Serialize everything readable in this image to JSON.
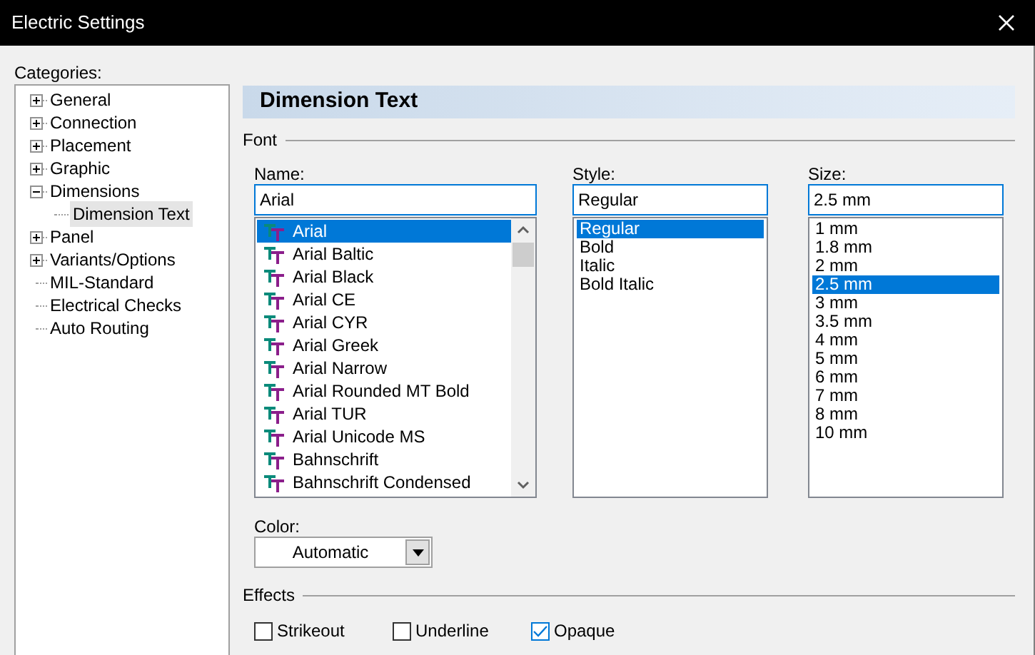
{
  "window": {
    "title": "Electric Settings"
  },
  "categories": {
    "label": "Categories:",
    "items": [
      {
        "label": "General",
        "expanded": false,
        "selected": false
      },
      {
        "label": "Connection",
        "expanded": false,
        "selected": false
      },
      {
        "label": "Placement",
        "expanded": false,
        "selected": false
      },
      {
        "label": "Graphic",
        "expanded": false,
        "selected": false
      },
      {
        "label": "Dimensions",
        "expanded": true,
        "selected": false,
        "children": [
          {
            "label": "Dimension Text",
            "selected": true
          }
        ]
      },
      {
        "label": "Panel",
        "expanded": false,
        "selected": false
      },
      {
        "label": "Variants/Options",
        "expanded": false,
        "selected": false
      },
      {
        "label": "MIL-Standard",
        "selected": false
      },
      {
        "label": "Electrical Checks",
        "selected": false
      },
      {
        "label": "Auto Routing",
        "selected": false
      }
    ]
  },
  "panel": {
    "title": "Dimension Text",
    "font_group": "Font",
    "name": {
      "label": "Name:",
      "value": "Arial",
      "items": [
        {
          "label": "Arial",
          "selected": true
        },
        {
          "label": "Arial Baltic",
          "selected": false
        },
        {
          "label": "Arial Black",
          "selected": false
        },
        {
          "label": "Arial CE",
          "selected": false
        },
        {
          "label": "Arial CYR",
          "selected": false
        },
        {
          "label": "Arial Greek",
          "selected": false
        },
        {
          "label": "Arial Narrow",
          "selected": false
        },
        {
          "label": "Arial Rounded MT Bold",
          "selected": false
        },
        {
          "label": "Arial TUR",
          "selected": false
        },
        {
          "label": "Arial Unicode MS",
          "selected": false
        },
        {
          "label": "Bahnschrift",
          "selected": false
        },
        {
          "label": "Bahnschrift Condensed",
          "selected": false
        }
      ]
    },
    "style": {
      "label": "Style:",
      "value": "Regular",
      "items": [
        {
          "label": "Regular",
          "selected": true
        },
        {
          "label": "Bold",
          "selected": false
        },
        {
          "label": "Italic",
          "selected": false
        },
        {
          "label": "Bold Italic",
          "selected": false
        }
      ]
    },
    "size": {
      "label": "Size:",
      "value": "2.5 mm",
      "items": [
        {
          "label": "1 mm",
          "selected": false
        },
        {
          "label": "1.8 mm",
          "selected": false
        },
        {
          "label": "2 mm",
          "selected": false
        },
        {
          "label": "2.5 mm",
          "selected": true
        },
        {
          "label": "3 mm",
          "selected": false
        },
        {
          "label": "3.5 mm",
          "selected": false
        },
        {
          "label": "4 mm",
          "selected": false
        },
        {
          "label": "5 mm",
          "selected": false
        },
        {
          "label": "6 mm",
          "selected": false
        },
        {
          "label": "7 mm",
          "selected": false
        },
        {
          "label": "8 mm",
          "selected": false
        },
        {
          "label": "10 mm",
          "selected": false
        }
      ]
    },
    "color": {
      "label": "Color:",
      "value": "Automatic"
    },
    "effects_group": "Effects",
    "effects": [
      {
        "label": "Strikeout",
        "checked": false
      },
      {
        "label": "Underline",
        "checked": false
      },
      {
        "label": "Opaque",
        "checked": true
      }
    ]
  }
}
